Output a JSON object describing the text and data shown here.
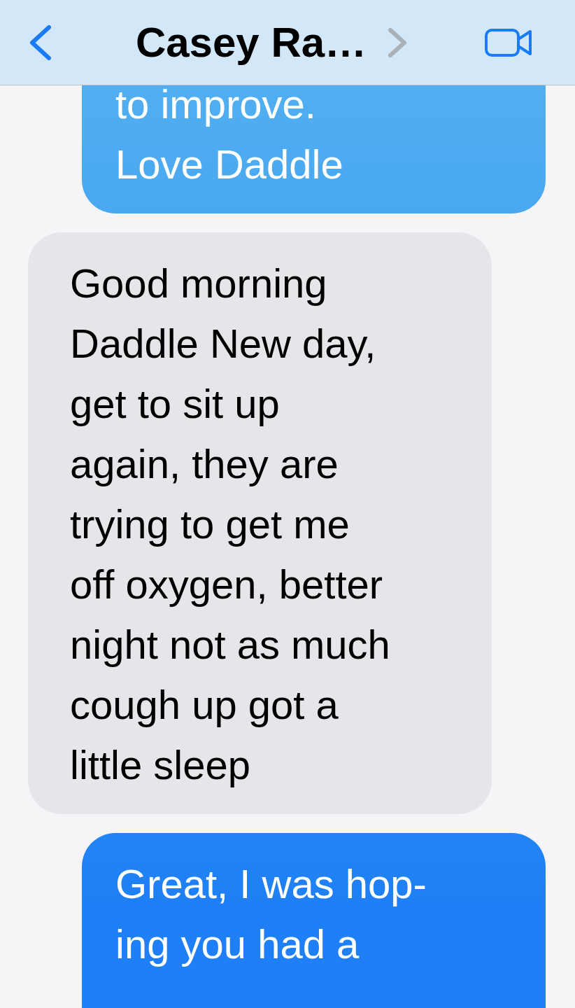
{
  "header": {
    "title": "Casey Ra…"
  },
  "messages": [
    {
      "kind": "sent",
      "lines": [
        "to improve.",
        "Love Daddle"
      ]
    },
    {
      "kind": "received",
      "lines": [
        "Good morning",
        "Daddle New day,",
        "get to sit up",
        "again, they are",
        "trying to get me",
        "off oxygen, better",
        "night not as much",
        "cough up got a",
        "little sleep"
      ]
    },
    {
      "kind": "sent",
      "lines": [
        "Great, I was hop-",
        "ing you had a"
      ]
    }
  ]
}
